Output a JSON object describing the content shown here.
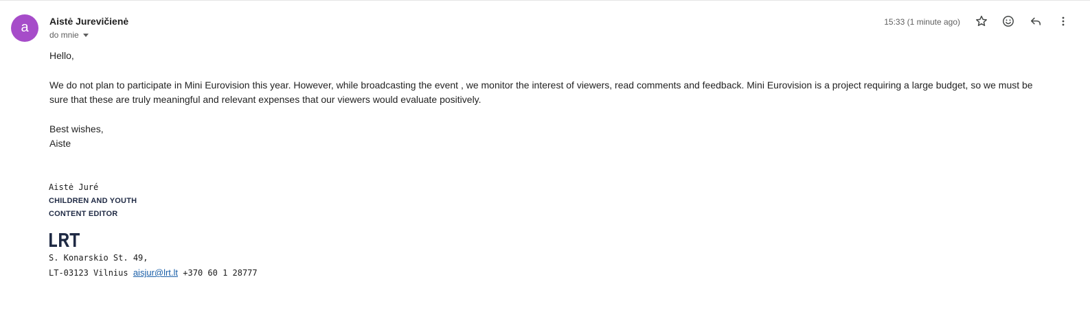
{
  "sender": {
    "avatar_letter": "a",
    "avatar_color": "#a64cc9",
    "name": "Aistė Jurevičienė",
    "recipient_label": "do mnie"
  },
  "header": {
    "timestamp": "15:33 (1 minute ago)",
    "icons": [
      "star-icon",
      "emoji-icon",
      "reply-icon",
      "more-vert-icon"
    ]
  },
  "body": {
    "greeting": "Hello,",
    "paragraph_line1": "We do not plan to participate in Mini Eurovision this year. However, while broadcasting the event , we monitor the interest of viewers, read comments and feedback. Mini Eurovision is a project requiring a large budget, so we must be",
    "paragraph_line2": "sure that these are truly meaningful and relevant expenses that our viewers would evaluate positively.",
    "closing": "Best wishes,",
    "sign_off": "Aiste"
  },
  "signature": {
    "name": "Aistė Juré",
    "role_line1": "CHILDREN AND YOUTH",
    "role_line2": "CONTENT EDITOR",
    "logo_text": "LRT",
    "address_line1": "S. Konarskio St. 49,",
    "address_line2_prefix": "LT-03123 Vilnius",
    "email": "aisjur@lrt.lt",
    "phone": "+370 60 1 28777"
  },
  "colors": {
    "link": "#1a5fa8",
    "logo": "#1f2a44"
  }
}
